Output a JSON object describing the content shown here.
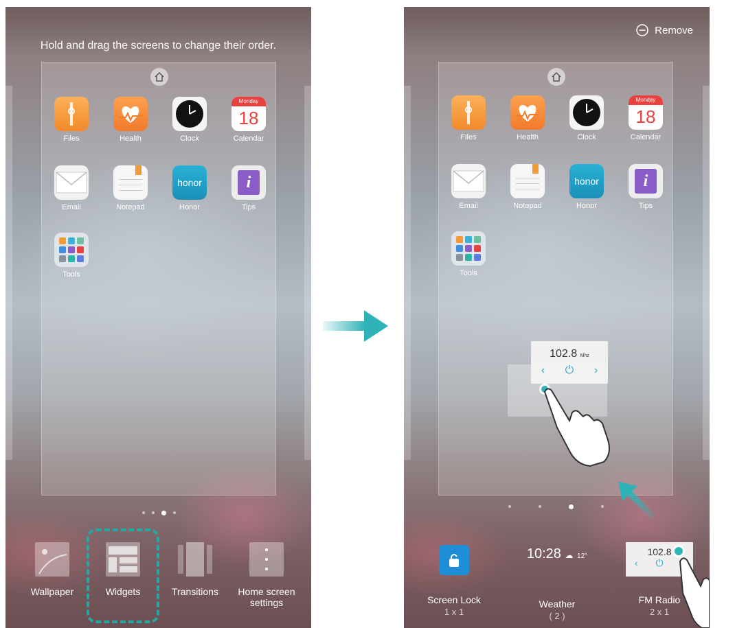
{
  "left_panel": {
    "hint": "Hold and drag the screens to change their order.",
    "apps": [
      {
        "label": "Files"
      },
      {
        "label": "Health"
      },
      {
        "label": "Clock"
      },
      {
        "label": "Calendar"
      },
      {
        "label": "Email"
      },
      {
        "label": "Notepad"
      },
      {
        "label": "Honor"
      },
      {
        "label": "Tips"
      },
      {
        "label": "Tools"
      }
    ],
    "calendar": {
      "day_name": "Monday",
      "day_number": "18"
    },
    "honor_logo": "honor",
    "page_dots": {
      "count": 4,
      "active_index": 2
    },
    "menu": [
      {
        "label": "Wallpaper",
        "icon": "wallpaper-icon"
      },
      {
        "label": "Widgets",
        "icon": "widgets-icon"
      },
      {
        "label": "Transitions",
        "icon": "transitions-icon"
      },
      {
        "label": "Home screen settings",
        "icon": "settings-dots-icon"
      }
    ],
    "highlight_color": "#27a7a3"
  },
  "right_panel": {
    "remove_label": "Remove",
    "apps": [
      {
        "label": "Files"
      },
      {
        "label": "Health"
      },
      {
        "label": "Clock"
      },
      {
        "label": "Calendar"
      },
      {
        "label": "Email"
      },
      {
        "label": "Notepad"
      },
      {
        "label": "Honor"
      },
      {
        "label": "Tips"
      },
      {
        "label": "Tools"
      }
    ],
    "calendar": {
      "day_name": "Monday",
      "day_number": "18"
    },
    "honor_logo": "honor",
    "fm_widget": {
      "frequency": "102.8",
      "unit": "Mhz"
    },
    "page_dots": {
      "count": 4,
      "active_index": 2
    },
    "tray": [
      {
        "label": "Screen Lock",
        "sub": "1 x 1"
      },
      {
        "label": "Weather",
        "sub": "( 2 )"
      },
      {
        "label": "FM Radio",
        "sub": "2 x 1"
      }
    ],
    "weather_widget": {
      "time": "10:28",
      "temp": "12°"
    },
    "tray_fm": {
      "frequency": "102.8"
    }
  },
  "accent_color": "#2fb3b8"
}
